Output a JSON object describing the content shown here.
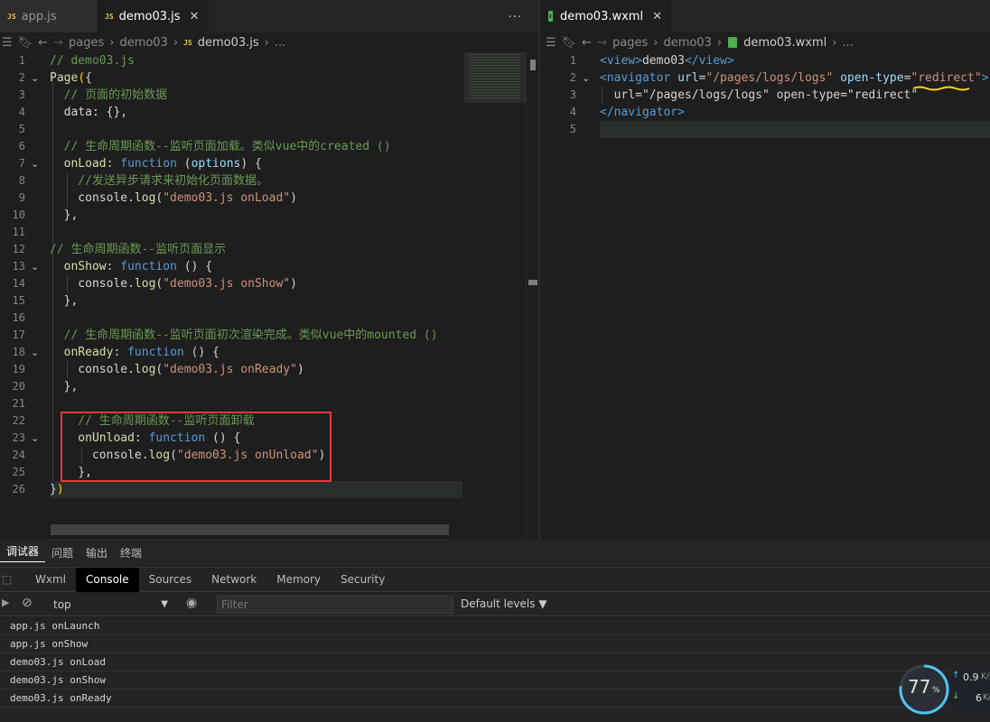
{
  "left_tabs": [
    {
      "label": "app.js",
      "active": false,
      "has_close": false
    },
    {
      "label": "demo03.js",
      "active": true,
      "has_close": true
    }
  ],
  "left_more": "...",
  "left_breadcrumb": [
    "pages",
    "demo03",
    "demo03.js",
    "..."
  ],
  "right_tab": {
    "label": "demo03.wxml"
  },
  "right_breadcrumb": [
    "pages",
    "demo03",
    "demo03.wxml",
    "..."
  ],
  "js_code": [
    {
      "n": "1",
      "tokens": [
        [
          "c-com",
          "// demo03.js"
        ]
      ]
    },
    {
      "n": "2",
      "fold": true,
      "tokens": [
        [
          "c-fn",
          "Page"
        ],
        [
          "c-brk",
          "("
        ],
        [
          "c-punc",
          "{"
        ]
      ]
    },
    {
      "n": "3",
      "tokens": [
        [
          "c-com",
          "  // 页面的初始数据"
        ]
      ]
    },
    {
      "n": "4",
      "tokens": [
        [
          "c-punc",
          "  data: {},"
        ]
      ]
    },
    {
      "n": "5",
      "tokens": []
    },
    {
      "n": "6",
      "tokens": [
        [
          "c-com",
          "  // 生命周期函数--监听页面加载。类似vue中的created ()"
        ]
      ]
    },
    {
      "n": "7",
      "fold": true,
      "tokens": [
        [
          "c-fn",
          "  onLoad"
        ],
        [
          "c-punc",
          ": "
        ],
        [
          "c-kw",
          "function"
        ],
        [
          "c-punc",
          " ("
        ],
        [
          "c-var",
          "options"
        ],
        [
          "c-punc",
          ") {"
        ]
      ]
    },
    {
      "n": "8",
      "tokens": [
        [
          "c-com",
          "    //发送异步请求来初始化页面数据。"
        ]
      ]
    },
    {
      "n": "9",
      "tokens": [
        [
          "c-punc",
          "    console."
        ],
        [
          "c-fn",
          "log"
        ],
        [
          "c-punc",
          "("
        ],
        [
          "c-str",
          "\"demo03.js onLoad\""
        ],
        [
          "c-punc",
          ")"
        ]
      ]
    },
    {
      "n": "10",
      "tokens": [
        [
          "c-punc",
          "  },"
        ]
      ]
    },
    {
      "n": "11",
      "tokens": []
    },
    {
      "n": "12",
      "tokens": [
        [
          "c-com",
          "// 生命周期函数--监听页面显示"
        ]
      ]
    },
    {
      "n": "13",
      "fold": true,
      "tokens": [
        [
          "c-fn",
          "  onShow"
        ],
        [
          "c-punc",
          ": "
        ],
        [
          "c-kw",
          "function"
        ],
        [
          "c-punc",
          " () {"
        ]
      ]
    },
    {
      "n": "14",
      "tokens": [
        [
          "c-punc",
          "    console."
        ],
        [
          "c-fn",
          "log"
        ],
        [
          "c-punc",
          "("
        ],
        [
          "c-str",
          "\"demo03.js onShow\""
        ],
        [
          "c-punc",
          ")"
        ]
      ]
    },
    {
      "n": "15",
      "tokens": [
        [
          "c-punc",
          "  },"
        ]
      ]
    },
    {
      "n": "16",
      "tokens": []
    },
    {
      "n": "17",
      "tokens": [
        [
          "c-com",
          "  // 生命周期函数--监听页面初次渲染完成。类似vue中的mounted ()"
        ]
      ]
    },
    {
      "n": "18",
      "fold": true,
      "tokens": [
        [
          "c-fn",
          "  onReady"
        ],
        [
          "c-punc",
          ": "
        ],
        [
          "c-kw",
          "function"
        ],
        [
          "c-punc",
          " () {"
        ]
      ]
    },
    {
      "n": "19",
      "tokens": [
        [
          "c-punc",
          "    console."
        ],
        [
          "c-fn",
          "log"
        ],
        [
          "c-punc",
          "("
        ],
        [
          "c-str",
          "\"demo03.js onReady\""
        ],
        [
          "c-punc",
          ")"
        ]
      ]
    },
    {
      "n": "20",
      "tokens": [
        [
          "c-punc",
          "  },"
        ]
      ]
    },
    {
      "n": "21",
      "tokens": []
    },
    {
      "n": "22",
      "tokens": [
        [
          "c-com",
          "    // 生命周期函数--监听页面卸载"
        ]
      ]
    },
    {
      "n": "23",
      "fold": true,
      "tokens": [
        [
          "c-fn",
          "    onUnload"
        ],
        [
          "c-punc",
          ": "
        ],
        [
          "c-kw",
          "function"
        ],
        [
          "c-punc",
          " () {"
        ]
      ]
    },
    {
      "n": "24",
      "tokens": [
        [
          "c-punc",
          "      console."
        ],
        [
          "c-fn",
          "log"
        ],
        [
          "c-punc",
          "("
        ],
        [
          "c-str",
          "\"demo03.js onUnload\""
        ],
        [
          "c-punc",
          ")"
        ]
      ]
    },
    {
      "n": "25",
      "tokens": [
        [
          "c-punc",
          "    },"
        ]
      ]
    },
    {
      "n": "26",
      "tokens": [
        [
          "c-punc",
          "}"
        ],
        [
          "c-brk",
          ")"
        ]
      ]
    }
  ],
  "wxml_code": [
    {
      "n": "1",
      "tokens": [
        [
          "c-tag",
          "<view>"
        ],
        [
          "c-punc",
          "demo03"
        ],
        [
          "c-tag",
          "</view>"
        ]
      ]
    },
    {
      "n": "2",
      "fold": true,
      "tokens": [
        [
          "c-tag",
          "<navigator "
        ],
        [
          "c-attr",
          "url"
        ],
        [
          "c-punc",
          "="
        ],
        [
          "c-str",
          "\"/pages/logs/logs\""
        ],
        [
          "c-punc",
          " "
        ],
        [
          "c-attr",
          "open-type"
        ],
        [
          "c-punc",
          "="
        ],
        [
          "c-str",
          "\"redirect\""
        ],
        [
          "c-tag",
          ">"
        ]
      ]
    },
    {
      "n": "3",
      "tokens": [
        [
          "c-punc",
          "  url=\"/pages/logs/logs\" open-type=\"redirect\""
        ]
      ]
    },
    {
      "n": "4",
      "tokens": [
        [
          "c-tag",
          "</navigator>"
        ]
      ]
    },
    {
      "n": "5",
      "tokens": []
    }
  ],
  "devtools": {
    "top_tabs": [
      "调试器",
      "问题",
      "输出",
      "终端"
    ],
    "panel_tabs": [
      "Wxml",
      "Console",
      "Sources",
      "Network",
      "Memory",
      "Security"
    ],
    "active_panel": "Console",
    "context": "top",
    "filter_placeholder": "Filter",
    "levels": "Default levels ▼",
    "logs": [
      "app.js onLaunch",
      "app.js onShow",
      "demo03.js onLoad",
      "demo03.js onShow",
      "demo03.js onReady"
    ]
  },
  "perf": {
    "percent": 77,
    "percent_unit": "%",
    "up": "0.9",
    "up_unit": "K/s",
    "down": "6",
    "down_unit": "K/s"
  },
  "colors": {
    "highlight_box": "#e53935",
    "underline": "#ffd700"
  }
}
